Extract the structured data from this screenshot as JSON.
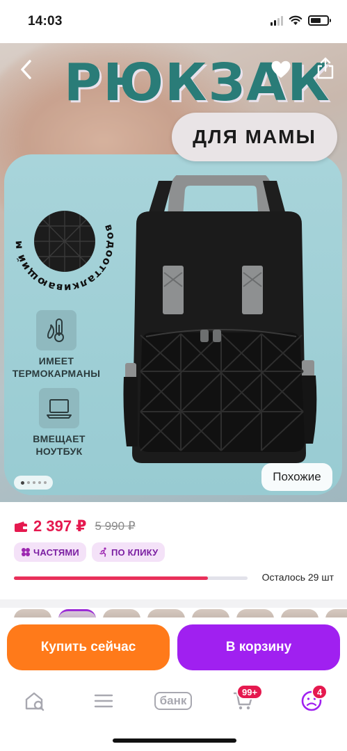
{
  "status_bar": {
    "time": "14:03"
  },
  "hero": {
    "title": "РЮКЗАК",
    "subtitle": "ДЛЯ МАМЫ",
    "badge_text": "водоотталкивающий материал",
    "features": [
      {
        "label": "ИМЕЕТ ТЕРМОКАРМАНЫ",
        "icon": "thermometer-icon"
      },
      {
        "label": "ВМЕЩАЕТ НОУТБУК",
        "icon": "laptop-icon"
      }
    ],
    "similar_label": "Похожие",
    "carousel_dots": 5,
    "carousel_active": 0
  },
  "price": {
    "current": "2 397 ₽",
    "old": "5 990 ₽",
    "chips": [
      {
        "label": "ЧАСТЯМИ",
        "icon": "parts-icon"
      },
      {
        "label": "ПО КЛИКУ",
        "icon": "running-person-icon"
      }
    ],
    "stock_text": "Осталось 29 шт",
    "stock_fraction": 0.83
  },
  "actions": {
    "buy_now": "Купить сейчас",
    "add_to_cart": "В корзину"
  },
  "tabbar": {
    "items": [
      {
        "name": "home",
        "icon": "home-search-icon"
      },
      {
        "name": "catalog",
        "icon": "menu-icon"
      },
      {
        "name": "bank",
        "label": "банк"
      },
      {
        "name": "cart",
        "icon": "cart-icon",
        "badge": "99+"
      },
      {
        "name": "profile",
        "icon": "profile-icon",
        "badge": "4"
      }
    ]
  },
  "colors": {
    "accent_pink": "#e5194f",
    "buy_orange": "#ff7a1a",
    "cart_purple": "#a020f0",
    "title_teal": "#2a7c78"
  }
}
